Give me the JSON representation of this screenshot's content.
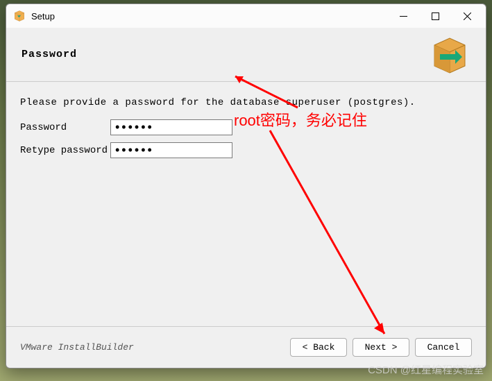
{
  "window": {
    "title": "Setup"
  },
  "header": {
    "title": "Password"
  },
  "content": {
    "description": "Please provide a password for the database superuser (postgres).",
    "password_label": "Password",
    "retype_label": "Retype password",
    "password_value": "••••••",
    "retype_value": "••••••"
  },
  "annotation": {
    "text": "root密码，务必记住"
  },
  "footer": {
    "builder_label": "VMware InstallBuilder",
    "back_label": "< Back",
    "next_label": "Next >",
    "cancel_label": "Cancel"
  },
  "watermark": "CSDN @红星编程实验室"
}
